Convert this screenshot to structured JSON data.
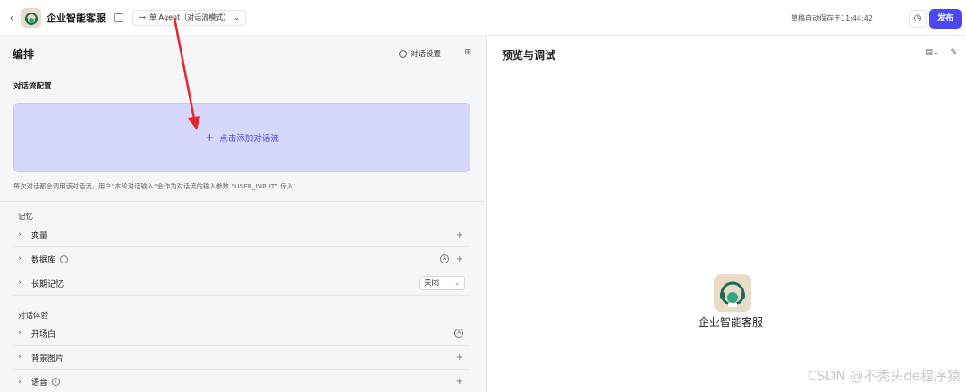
{
  "header": {
    "app_title": "企业智能客服",
    "mode_label": "单 Agent（对话流模式）",
    "save_status": "草稿自动保存于11:44:42",
    "publish_label": "发布"
  },
  "left": {
    "title": "编排",
    "settings_label": "对话设置",
    "flow_config_label": "对话流配置",
    "add_flow_label": "点击添加对话流",
    "flow_hint": "每次对话都会调用该对话流，用户“本轮对话输入”会作为对话流的输入参数 “USER_INPUT” 传入",
    "memory_group": "记忆",
    "memory_rows": [
      "变量",
      "数据库",
      "长期记忆"
    ],
    "long_memory_value": "关闭",
    "experience_group": "对话体验",
    "experience_rows": [
      "开场白",
      "背景图片",
      "语音"
    ]
  },
  "right": {
    "title": "预览与调试",
    "bot_name": "企业智能客服"
  },
  "watermark": "CSDN @不秃头de程序猿",
  "colors": {
    "accent": "#4c48ef",
    "flow_box": "#d6d8fb",
    "arrow": "#e8262a"
  }
}
